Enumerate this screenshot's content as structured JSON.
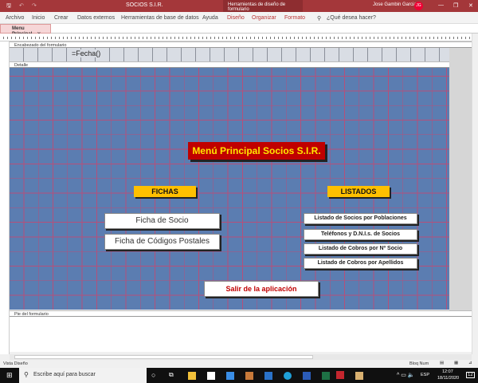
{
  "titlebar": {
    "app_title": "SOCIOS S.I.R.",
    "context_tab": "Herramientas de diseño de formulario",
    "user": "Jose Gambin Garcia",
    "initials": "JG"
  },
  "ribbon": {
    "tabs": [
      "Archivo",
      "Inicio",
      "Crear",
      "Datos externos",
      "Herramientas de base de datos",
      "Ayuda",
      "Diseño",
      "Organizar",
      "Formato"
    ],
    "search": "¿Qué desea hacer?"
  },
  "doc_tab": "Menu Principal",
  "sections": {
    "header": "Encabezado del formulario",
    "detail": "Detalle",
    "footer": "Pie del formulario"
  },
  "header_field": "=Fecha()",
  "form": {
    "title": "Menú Principal Socios S.I.R.",
    "fichas_label": "FICHAS",
    "listados_label": "LISTADOS",
    "fichas": [
      "Ficha de Socio",
      "Ficha de Códigos Postales"
    ],
    "listados": [
      "Listado de Socios por Poblaciones",
      "Teléfonos y D.N.I.s. de Socios",
      "Listado de Cobros por Nº Socio",
      "Listado de Cobros por Apellidos"
    ],
    "exit": "Salir de la aplicación"
  },
  "status": {
    "view": "Vista Diseño",
    "num": "Bloq Num"
  },
  "taskbar": {
    "search": "Escribe aquí para buscar",
    "lang": "ESP",
    "time": "12:07",
    "date": "18/11/2020",
    "notifications": "12"
  },
  "colors": {
    "titlebar": "#a4373a",
    "canvas": "#5b7db1",
    "title_bg": "#c00000",
    "title_text": "#ffe600",
    "label_bg": "#ffc000"
  }
}
